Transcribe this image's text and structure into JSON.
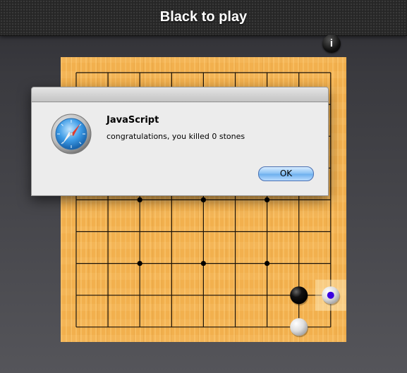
{
  "header": {
    "title": "Black to play"
  },
  "info_button": {
    "icon": "info-icon",
    "glyph": "i"
  },
  "board": {
    "size": 9,
    "stones": [
      {
        "color": "black",
        "col": 7,
        "row": 7
      },
      {
        "color": "white",
        "col": 8,
        "row": 7,
        "marked": true
      },
      {
        "color": "white",
        "col": 7,
        "row": 8
      }
    ],
    "star_points": [
      {
        "col": 2,
        "row": 4
      },
      {
        "col": 4,
        "row": 4
      },
      {
        "col": 6,
        "row": 4
      },
      {
        "col": 2,
        "row": 6
      },
      {
        "col": 4,
        "row": 6
      },
      {
        "col": 6,
        "row": 6
      }
    ],
    "last_move_marker_color": "#3a00e0",
    "wood_color": "#f2b04e"
  },
  "dialog": {
    "title": "JavaScript",
    "message": "congratulations, you killed 0 stones",
    "ok_label": "OK",
    "icon": "safari-compass-icon"
  }
}
